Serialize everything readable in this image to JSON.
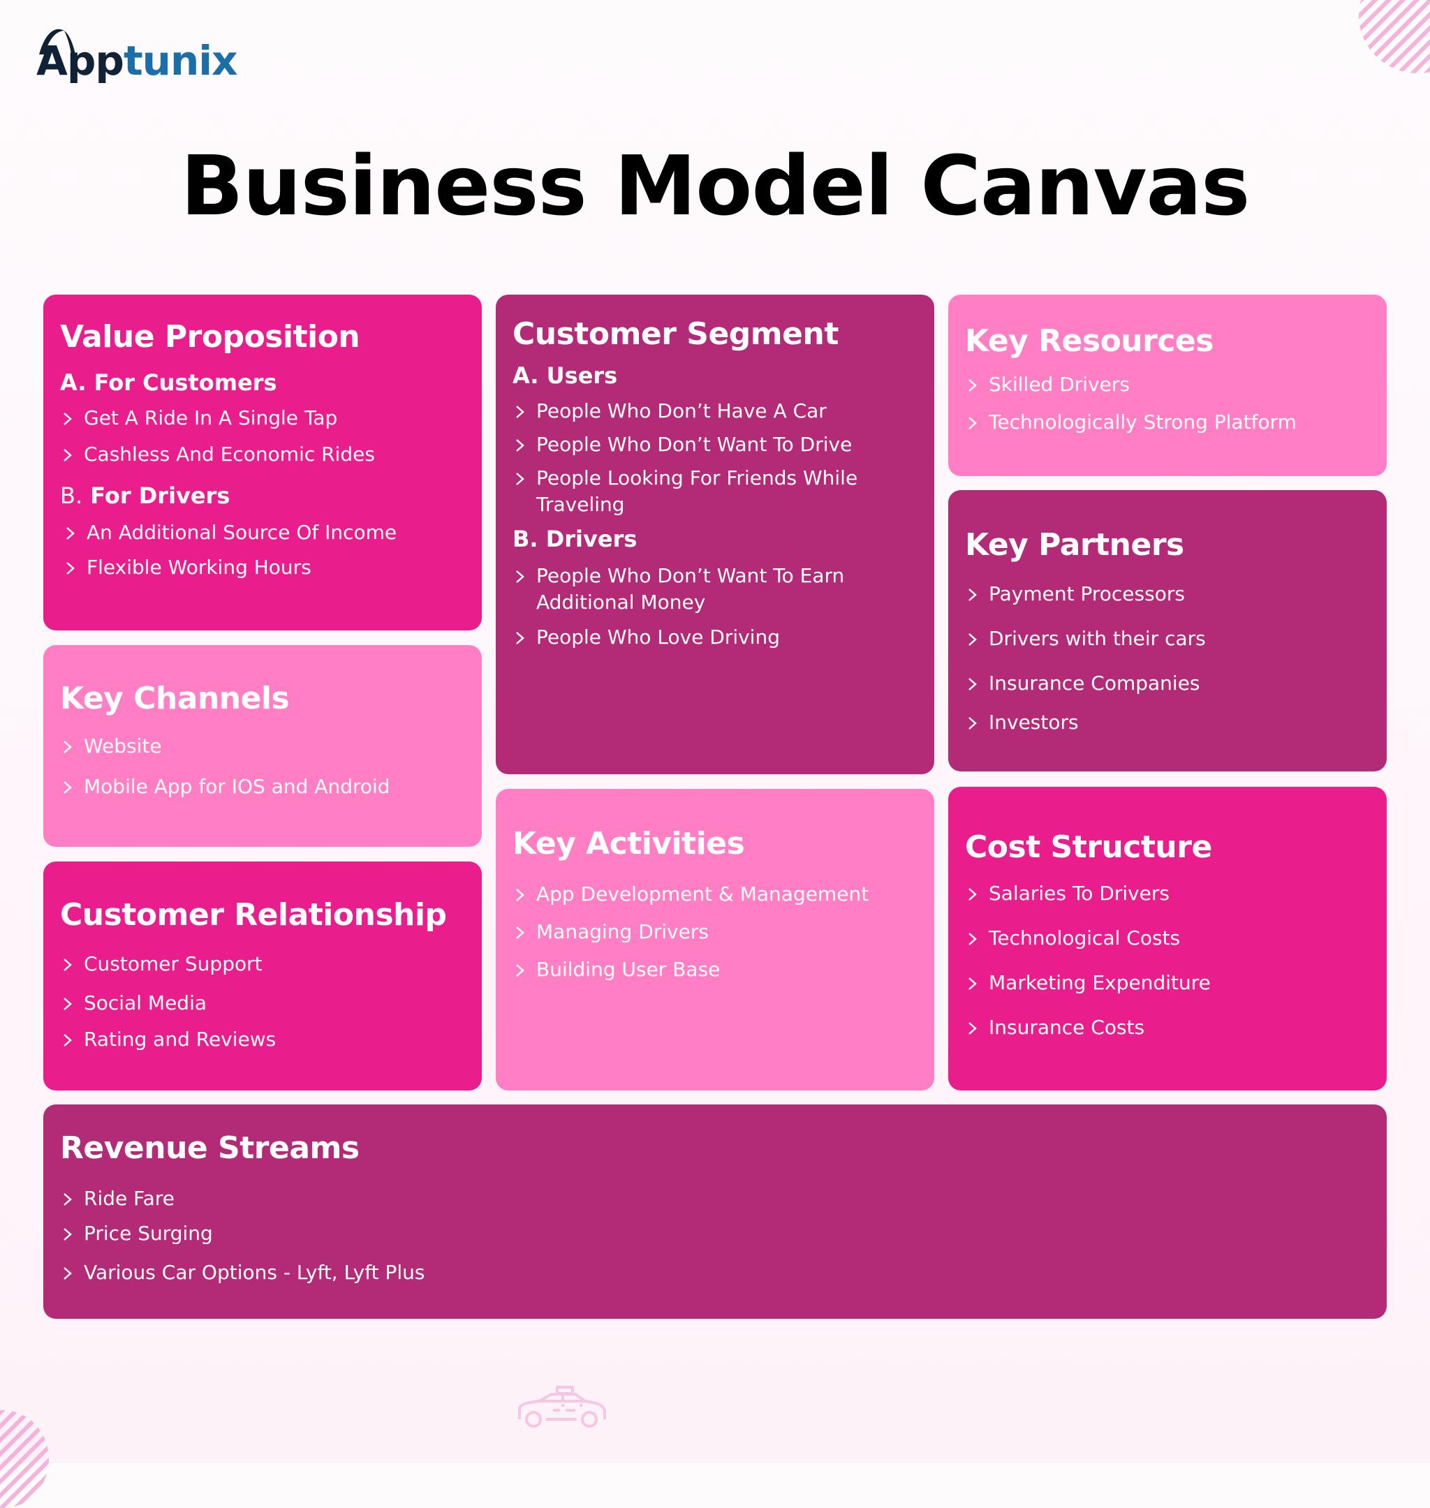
{
  "brand": {
    "logo_dark": "App",
    "logo_blue": "tunix",
    "colors": {
      "dark": "#0f2236",
      "blue": "#1a6fa8"
    }
  },
  "title": "Business Model Canvas",
  "colors": {
    "hot_pink": "#e91e8c",
    "light_pink": "#ff7ec4",
    "plum": "#b32b77",
    "background": "#fef4fa"
  },
  "value_proposition": {
    "title": "Value Proposition",
    "groups": [
      {
        "prefix": "A.",
        "label": "For Customers",
        "items": [
          "Get A Ride In A Single Tap",
          "Cashless And Economic Rides"
        ]
      },
      {
        "prefix": "B.",
        "label": "For Drivers",
        "items": [
          "An Additional Source Of Income",
          "Flexible Working Hours"
        ]
      }
    ]
  },
  "key_channels": {
    "title": "Key Channels",
    "items": [
      "Website",
      "Mobile App for IOS and Android"
    ]
  },
  "customer_relationship": {
    "title": "Customer Relationship",
    "items": [
      "Customer Support",
      "Social Media",
      "Rating and Reviews"
    ]
  },
  "customer_segment": {
    "title": "Customer Segment",
    "groups": [
      {
        "prefix": "A.",
        "label": "Users",
        "items": [
          "People Who Don’t Have A Car",
          "People Who Don’t Want To Drive",
          "People Looking For Friends While Traveling"
        ]
      },
      {
        "prefix": "B.",
        "label": "Drivers",
        "items": [
          "People Who Don’t Want To Earn Additional Money",
          "People Who Love Driving"
        ]
      }
    ]
  },
  "key_activities": {
    "title": "Key Activities",
    "items": [
      "App Development & Management",
      "Managing Drivers",
      "Building User Base"
    ]
  },
  "key_resources": {
    "title": "Key Resources",
    "items": [
      "Skilled Drivers",
      "Technologically Strong Platform"
    ]
  },
  "key_partners": {
    "title": "Key Partners",
    "items": [
      "Payment Processors",
      "Drivers with their cars",
      "Insurance Companies",
      "Investors"
    ]
  },
  "cost_structure": {
    "title": "Cost Structure",
    "items": [
      "Salaries To Drivers",
      "Technological Costs",
      "Marketing Expenditure",
      "Insurance Costs"
    ]
  },
  "revenue_streams": {
    "title": "Revenue Streams",
    "items": [
      "Ride Fare",
      "Price Surging",
      "Various Car Options - Lyft, Lyft Plus"
    ]
  },
  "decor": {
    "car_icon": "taxi-car-icon",
    "stripes": "striped-circle-decoration"
  }
}
